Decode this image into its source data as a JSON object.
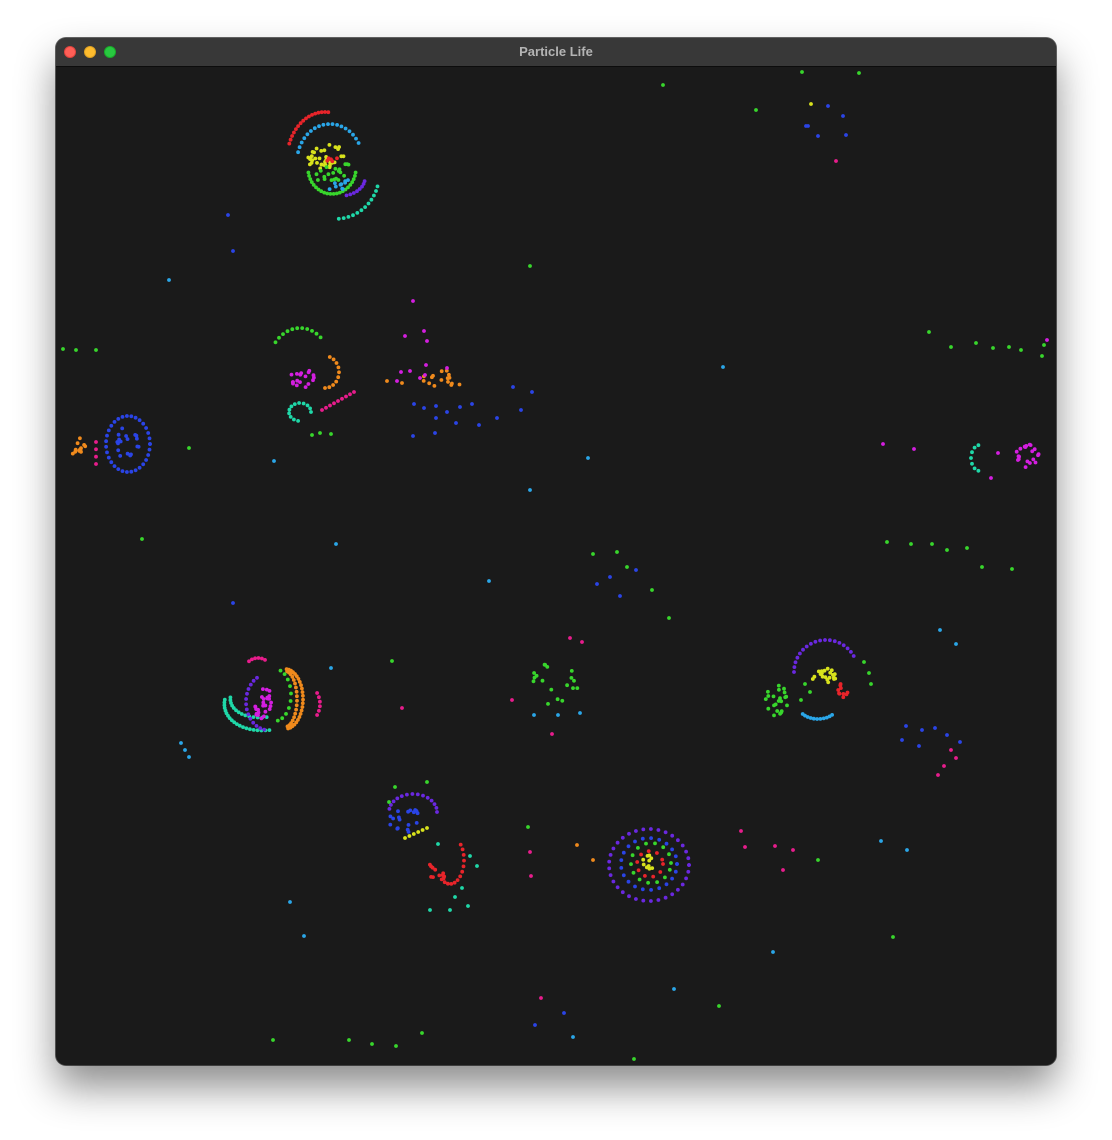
{
  "window": {
    "title": "Particle Life",
    "controls": [
      "close-button",
      "minimize-button",
      "zoom-button"
    ]
  },
  "canvas": {
    "background": "#1a1a1a",
    "particle_colors": {
      "red": "#e8242a",
      "orange": "#f08a1c",
      "yellow": "#d8e21c",
      "green": "#38d62c",
      "teal": "#1fd8a8",
      "cyan": "#2aa6e8",
      "blue": "#2a44e6",
      "purple": "#6a28e0",
      "magenta": "#d41ee0",
      "pink": "#e81c8c"
    }
  }
}
